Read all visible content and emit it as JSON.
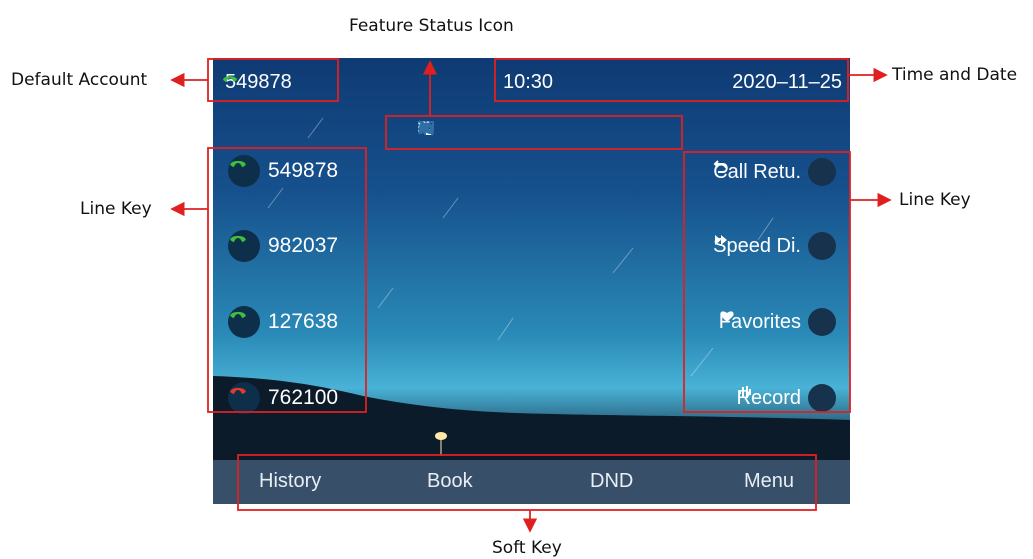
{
  "callouts": {
    "feature_status_icon": "Feature Status Icon",
    "default_account": "Default Account",
    "time_and_date": "Time and Date",
    "line_key_left": "Line Key",
    "line_key_right": "Line Key",
    "soft_key": "Soft Key"
  },
  "status_bar": {
    "account": "549878",
    "time": "10:30",
    "date": "2020–11–25"
  },
  "feature_icons": [
    "monitor-icon",
    "monitor-outline-icon",
    "dnd-icon",
    "dialpad-lock-icon",
    "phone-forward-icon",
    "headset-icon",
    "network-icon",
    "mute-icon"
  ],
  "line_keys_left": [
    {
      "label": "549878",
      "status": "green"
    },
    {
      "label": "982037",
      "status": "green"
    },
    {
      "label": "127638",
      "status": "green"
    },
    {
      "label": "762100",
      "status": "red"
    }
  ],
  "line_keys_right": [
    {
      "label": "Call Retu.",
      "icon": "return-icon"
    },
    {
      "label": "Speed Di.",
      "icon": "fast-forward-icon"
    },
    {
      "label": "Favorites",
      "icon": "heart-icon"
    },
    {
      "label": "Record",
      "icon": "record-icon"
    }
  ],
  "soft_keys": [
    "History",
    "Book",
    "DND",
    "Menu"
  ],
  "colors": {
    "accent_green": "#3fbf3f",
    "accent_red": "#e23b2e",
    "callout_red": "#e02020"
  }
}
